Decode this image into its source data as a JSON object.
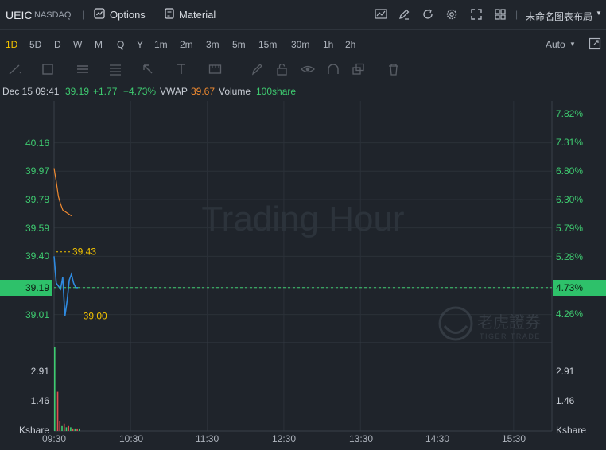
{
  "header": {
    "symbol": "UEIC",
    "exchange": "NASDAQ",
    "divider": "|",
    "options_label": "Options",
    "material_label": "Material",
    "layout_label": "未命名图表布局"
  },
  "timeframes": [
    "1D",
    "5D",
    "D",
    "W",
    "M",
    "Q",
    "Y",
    "1m",
    "2m",
    "3m",
    "5m",
    "15m",
    "30m",
    "1h",
    "2h"
  ],
  "active_timeframe": "1D",
  "auto_label": "Auto",
  "info": {
    "datetime": "Dec 15 09:41",
    "price": "39.19",
    "change": "+1.77",
    "change_pct": "+4.73%",
    "vwap_label": "VWAP",
    "vwap_value": "39.67",
    "volume_label": "Volume",
    "volume_value": "100share"
  },
  "watermark": "Trading Hour",
  "logo": {
    "cn": "老虎證券",
    "en": "TIGER TRADE"
  },
  "price_axis": [
    "40.16",
    "39.97",
    "39.78",
    "39.59",
    "39.40",
    "39.19",
    "39.01"
  ],
  "pct_axis": [
    "7.82%",
    "7.31%",
    "6.80%",
    "6.30%",
    "5.79%",
    "5.28%",
    "4.73%",
    "4.26%"
  ],
  "current_price_label": "39.19",
  "current_pct_label": "4.73%",
  "high_marker": "39.43",
  "low_marker": "39.00",
  "volume_axis": [
    "2.91",
    "1.46"
  ],
  "volume_unit": "Kshare",
  "time_axis": [
    "09:30",
    "10:30",
    "11:30",
    "12:30",
    "13:30",
    "14:30",
    "15:30"
  ],
  "colors": {
    "up": "#3ecb70",
    "accent": "#f2c200",
    "price_line": "#2f8ae0",
    "vwap_line": "#f08a30",
    "current_tag": "#2ec16a"
  },
  "chart_data": {
    "type": "line",
    "x": [
      "09:30",
      "09:31",
      "09:32",
      "09:33",
      "09:34",
      "09:35",
      "09:36",
      "09:37",
      "09:38",
      "09:39",
      "09:40",
      "09:41"
    ],
    "series": [
      {
        "values": [
          39.4,
          39.22,
          39.2,
          39.18,
          39.26,
          39.0,
          39.1,
          39.24,
          39.28,
          39.22,
          39.19,
          39.19
        ]
      }
    ],
    "vwap": [
      39.99,
      39.9,
      39.8,
      39.75,
      39.71,
      39.7,
      39.69,
      39.68,
      39.67,
      39.67,
      39.67,
      39.67
    ],
    "volume_kshare": [
      3.4,
      1.6,
      0.4,
      0.2,
      0.3,
      0.15,
      0.2,
      0.15,
      0.1,
      0.1,
      0.1,
      0.1
    ],
    "ylim": [
      38.92,
      40.26
    ],
    "ylabel_right": "%"
  }
}
